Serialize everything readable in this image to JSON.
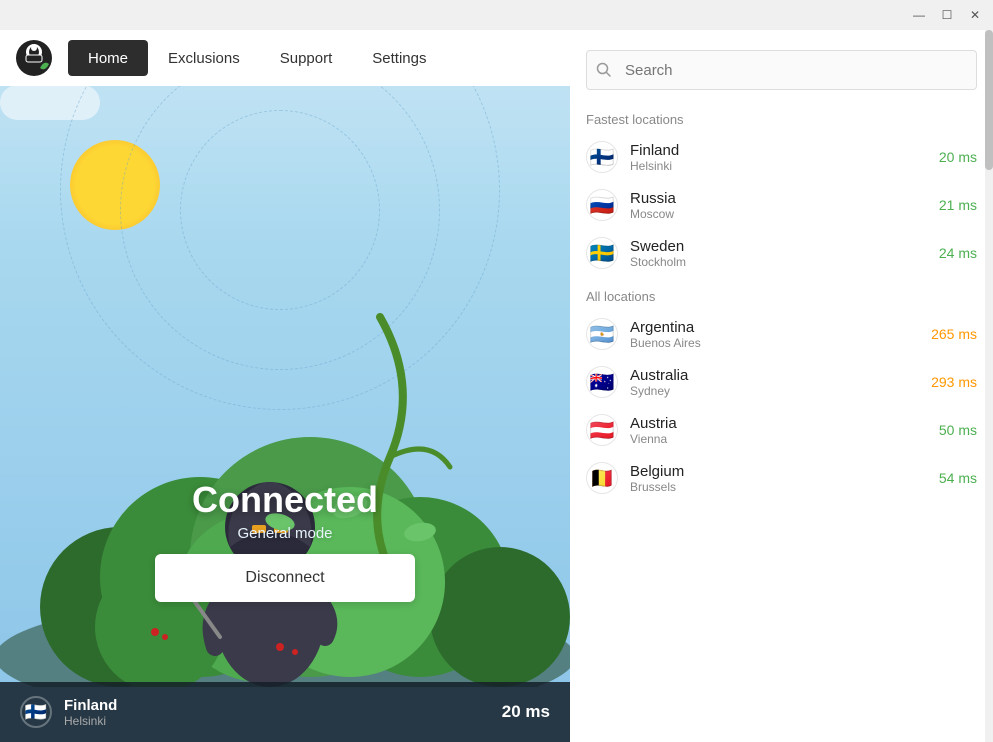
{
  "titlebar": {
    "minimize_label": "—",
    "maximize_label": "☐",
    "close_label": "✕"
  },
  "navbar": {
    "home_label": "Home",
    "exclusions_label": "Exclusions",
    "support_label": "Support",
    "settings_label": "Settings"
  },
  "hero": {
    "status": "Connected",
    "mode": "General mode",
    "disconnect_label": "Disconnect"
  },
  "bottom_bar": {
    "country": "Finland",
    "city": "Helsinki",
    "ms": "20 ms",
    "flag_emoji": "🇫🇮"
  },
  "search": {
    "placeholder": "Search"
  },
  "fastest_locations": {
    "label": "Fastest locations",
    "items": [
      {
        "country": "Finland",
        "city": "Helsinki",
        "ms": "20 ms",
        "ms_class": "ms-fast",
        "flag": "🇫🇮"
      },
      {
        "country": "Russia",
        "city": "Moscow",
        "ms": "21 ms",
        "ms_class": "ms-fast",
        "flag": "🇷🇺"
      },
      {
        "country": "Sweden",
        "city": "Stockholm",
        "ms": "24 ms",
        "ms_class": "ms-fast",
        "flag": "🇸🇪"
      }
    ]
  },
  "all_locations": {
    "label": "All locations",
    "items": [
      {
        "country": "Argentina",
        "city": "Buenos Aires",
        "ms": "265 ms",
        "ms_class": "ms-medium",
        "flag": "🇦🇷"
      },
      {
        "country": "Australia",
        "city": "Sydney",
        "ms": "293 ms",
        "ms_class": "ms-medium",
        "flag": "🇦🇺"
      },
      {
        "country": "Austria",
        "city": "Vienna",
        "ms": "50 ms",
        "ms_class": "ms-fast",
        "flag": "🇦🇹"
      },
      {
        "country": "Belgium",
        "city": "Brussels",
        "ms": "54 ms",
        "ms_class": "ms-fast",
        "flag": "🇧🇪"
      }
    ]
  }
}
